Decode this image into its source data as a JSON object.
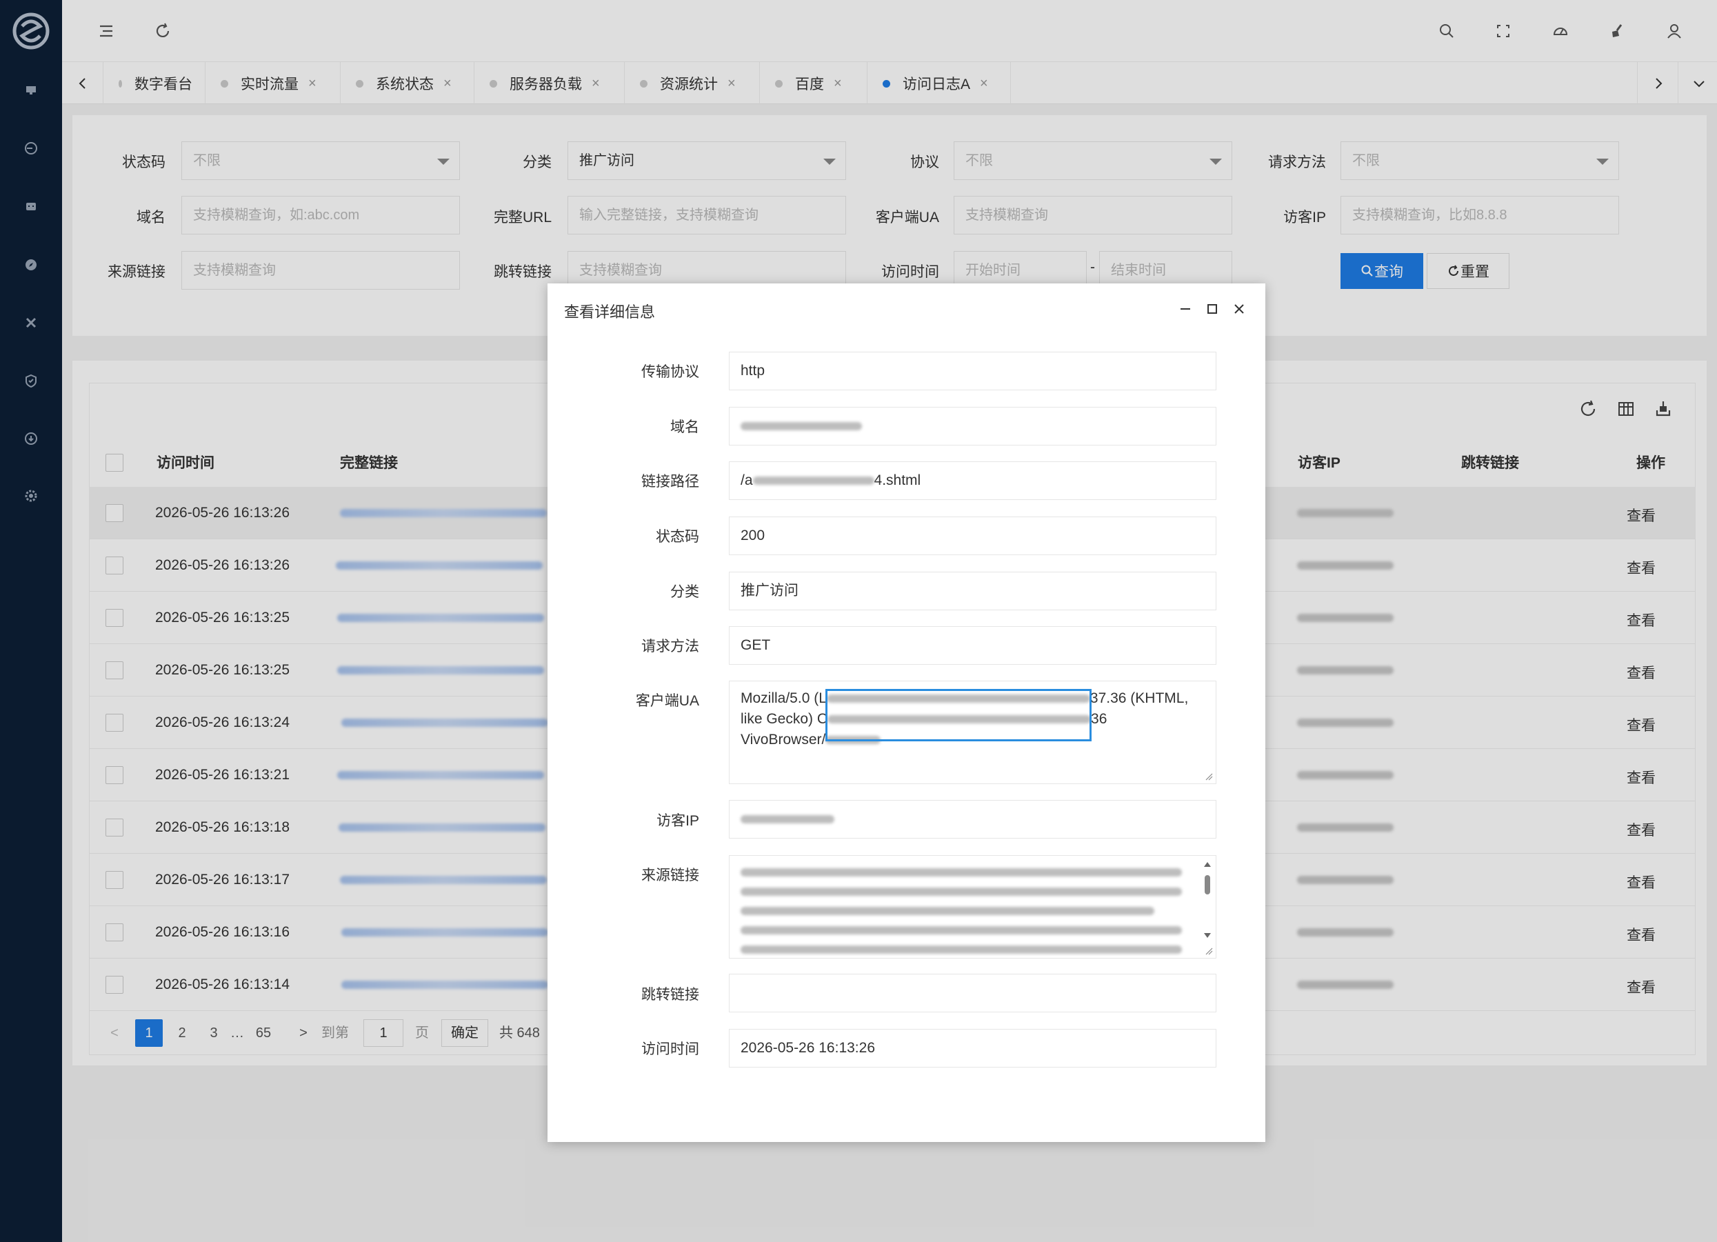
{
  "tabs": [
    {
      "label": "数字看台",
      "closable": false,
      "active": false
    },
    {
      "label": "实时流量",
      "closable": true,
      "active": false
    },
    {
      "label": "系统状态",
      "closable": true,
      "active": false
    },
    {
      "label": "服务器负载",
      "closable": true,
      "active": false
    },
    {
      "label": "资源统计",
      "closable": true,
      "active": false
    },
    {
      "label": "百度",
      "closable": true,
      "active": false
    },
    {
      "label": "访问日志A",
      "closable": true,
      "active": true
    }
  ],
  "tab_close_glyph": "×",
  "filters": {
    "status_code": {
      "label": "状态码",
      "placeholder": "不限"
    },
    "category": {
      "label": "分类",
      "value": "推广访问"
    },
    "protocol": {
      "label": "协议",
      "placeholder": "不限"
    },
    "method": {
      "label": "请求方法",
      "placeholder": "不限"
    },
    "domain": {
      "label": "域名",
      "placeholder": "支持模糊查询，如:abc.com"
    },
    "full_url": {
      "label": "完整URL",
      "placeholder": "输入完整链接，支持模糊查询"
    },
    "ua": {
      "label": "客户端UA",
      "placeholder": "支持模糊查询"
    },
    "visitor_ip": {
      "label": "访客IP",
      "placeholder": "支持模糊查询，比如8.8.8"
    },
    "referer": {
      "label": "来源链接",
      "placeholder": "支持模糊查询"
    },
    "redirect": {
      "label": "跳转链接",
      "placeholder": "支持模糊查询"
    },
    "visit_time": {
      "label": "访问时间",
      "start_placeholder": "开始时间",
      "end_placeholder": "结束时间",
      "separator": "-"
    },
    "query_button": "查询",
    "reset_button": "重置"
  },
  "table": {
    "headers": [
      "访问时间",
      "完整链接",
      "访客IP",
      "跳转链接",
      "操作"
    ],
    "rows": [
      {
        "time": "2026-05-26 16:13:26",
        "action": "查看"
      },
      {
        "time": "2026-05-26 16:13:26",
        "action": "查看"
      },
      {
        "time": "2026-05-26 16:13:25",
        "action": "查看"
      },
      {
        "time": "2026-05-26 16:13:25",
        "action": "查看"
      },
      {
        "time": "2026-05-26 16:13:24",
        "action": "查看"
      },
      {
        "time": "2026-05-26 16:13:21",
        "action": "查看"
      },
      {
        "time": "2026-05-26 16:13:18",
        "action": "查看"
      },
      {
        "time": "2026-05-26 16:13:17",
        "action": "查看"
      },
      {
        "time": "2026-05-26 16:13:16",
        "action": "查看"
      },
      {
        "time": "2026-05-26 16:13:14",
        "action": "查看"
      }
    ]
  },
  "pager": {
    "prev": "<",
    "next": ">",
    "pages": [
      "1",
      "2",
      "3"
    ],
    "ellipsis": "…",
    "last": "65",
    "goto_label": "到第",
    "goto_value": "1",
    "page_unit": "页",
    "confirm": "确定",
    "total": "共 648"
  },
  "modal": {
    "title": "查看详细信息",
    "fields": {
      "protocol": {
        "label": "传输协议",
        "value": "http"
      },
      "domain": {
        "label": "域名"
      },
      "path": {
        "label": "链接路径",
        "prefix": "/a",
        "suffix": "4.shtml"
      },
      "status": {
        "label": "状态码",
        "value": "200"
      },
      "category": {
        "label": "分类",
        "value": "推广访问"
      },
      "method": {
        "label": "请求方法",
        "value": "GET"
      },
      "ua": {
        "label": "客户端UA",
        "part1": "Mozilla/5.0 (L",
        "part2": "37.36 (KHTML,",
        "part3": "like Gecko) C",
        "part4": "36",
        "part5": "VivoBrowser/"
      },
      "visitor_ip": {
        "label": "访客IP"
      },
      "referer": {
        "label": "来源链接"
      },
      "redirect": {
        "label": "跳转链接",
        "value": ""
      },
      "visit_time": {
        "label": "访问时间",
        "value": "2026-05-26 16:13:26"
      }
    }
  },
  "colors": {
    "sidebar": "#0d1f36",
    "accent": "#1e7ce6"
  },
  "icons": [
    "menu-fold-icon",
    "refresh-icon",
    "search-icon",
    "fullscreen-icon",
    "dashboard-icon",
    "clean-icon",
    "user-icon"
  ]
}
